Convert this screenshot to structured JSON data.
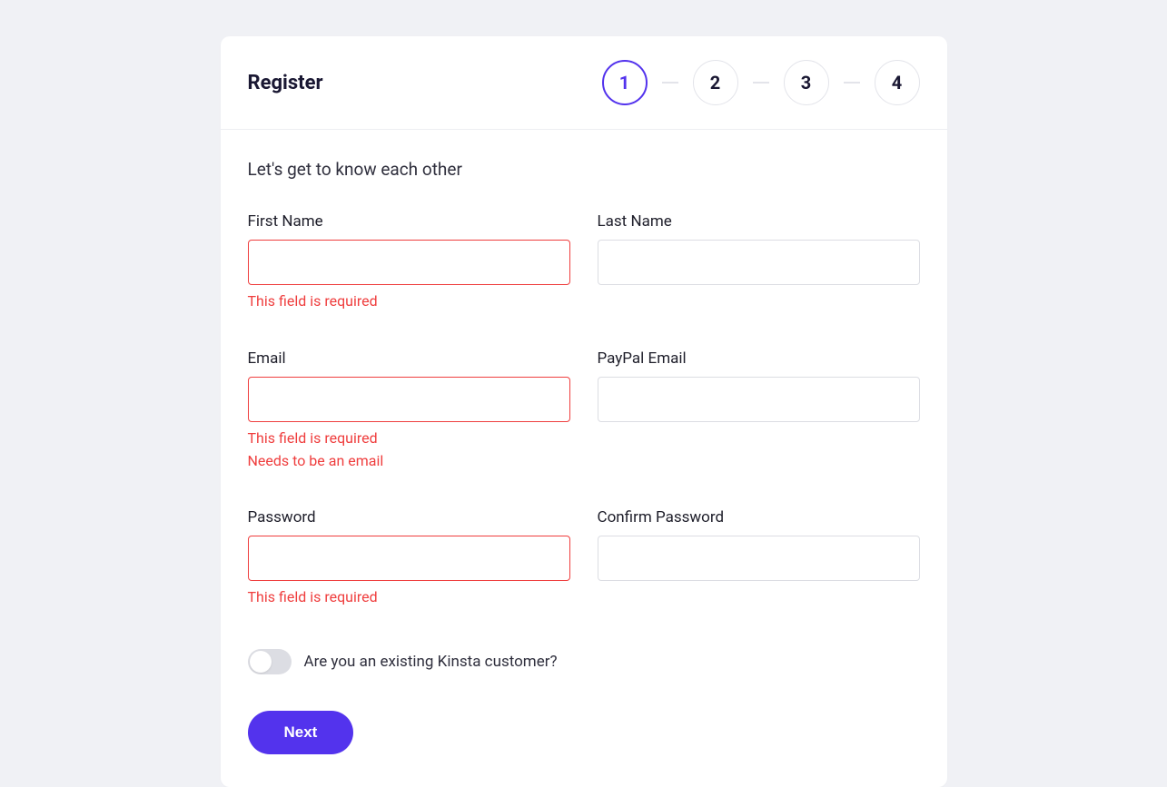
{
  "header": {
    "title": "Register",
    "steps": [
      "1",
      "2",
      "3",
      "4"
    ],
    "active_step": 0
  },
  "subtitle": "Let's get to know each other",
  "fields": {
    "first_name": {
      "label": "First Name",
      "value": "",
      "errors": [
        "This field is required"
      ]
    },
    "last_name": {
      "label": "Last Name",
      "value": "",
      "errors": []
    },
    "email": {
      "label": "Email",
      "value": "",
      "errors": [
        "This field is required",
        "Needs to be an email"
      ]
    },
    "paypal_email": {
      "label": "PayPal Email",
      "value": "",
      "errors": []
    },
    "password": {
      "label": "Password",
      "value": "",
      "errors": [
        "This field is required"
      ]
    },
    "confirm_password": {
      "label": "Confirm Password",
      "value": "",
      "errors": []
    }
  },
  "toggle": {
    "label": "Are you an existing Kinsta customer?",
    "value": false
  },
  "buttons": {
    "next": "Next"
  },
  "colors": {
    "accent": "#5333ed",
    "error": "#ef3e3e",
    "background": "#f0f1f5"
  }
}
